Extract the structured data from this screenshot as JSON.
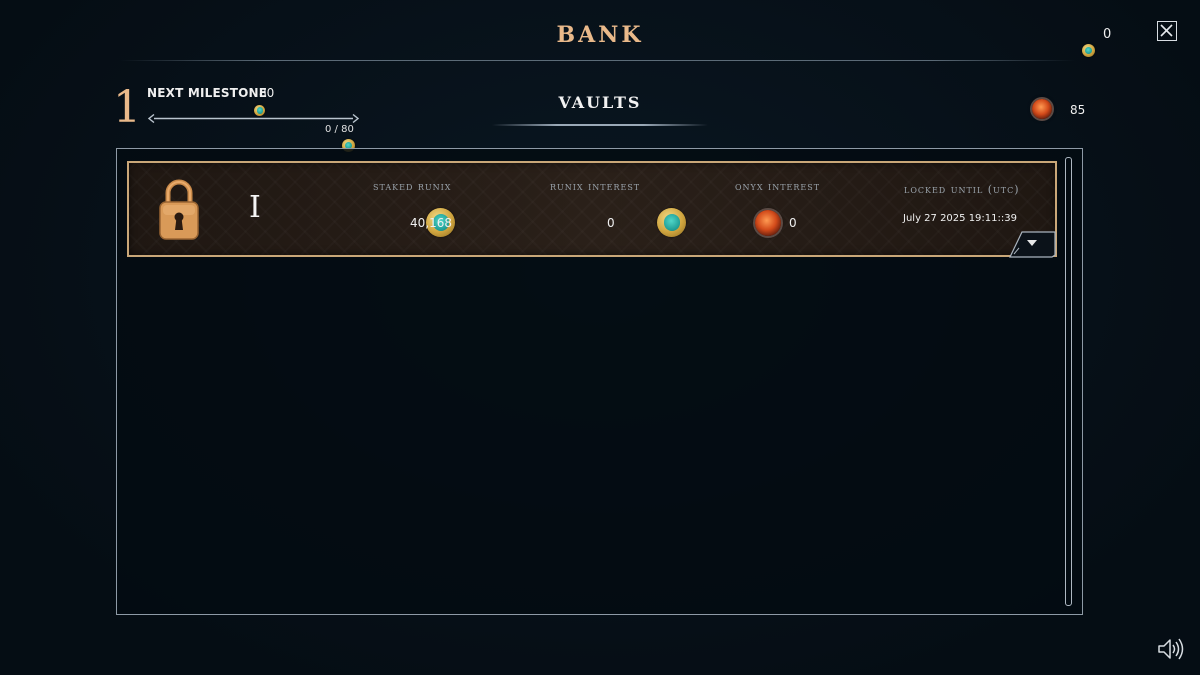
{
  "header": {
    "title": "BANK",
    "coin_amount": "0",
    "close_icon": "close-x-icon"
  },
  "milestone": {
    "level": "1",
    "label": "Next Milestone",
    "target_amount": "80",
    "progress_text": "0 / 80",
    "progress_fraction": 0
  },
  "vaults": {
    "title": "VAULTS",
    "onyx_total": "85",
    "items": [
      {
        "index": "I",
        "staked_label": "Staked Runix",
        "staked_value": "40,168",
        "runix_interest_label": "Runix Interest",
        "runix_interest_value": "0",
        "onyx_interest_label": "Onyx Interest",
        "onyx_interest_value": "0",
        "locked_label": "Locked Until (UTC)",
        "locked_value": "July 27 2025 19:11::39"
      }
    ]
  },
  "colors": {
    "accent_gold": "#e9b98a",
    "row_border": "#c9a778",
    "background": "#06111a"
  },
  "icons": [
    "runix-coin-icon",
    "onyx-gem-icon",
    "lock-icon",
    "close-x-icon",
    "dropdown-arrow-icon",
    "speaker-icon"
  ]
}
